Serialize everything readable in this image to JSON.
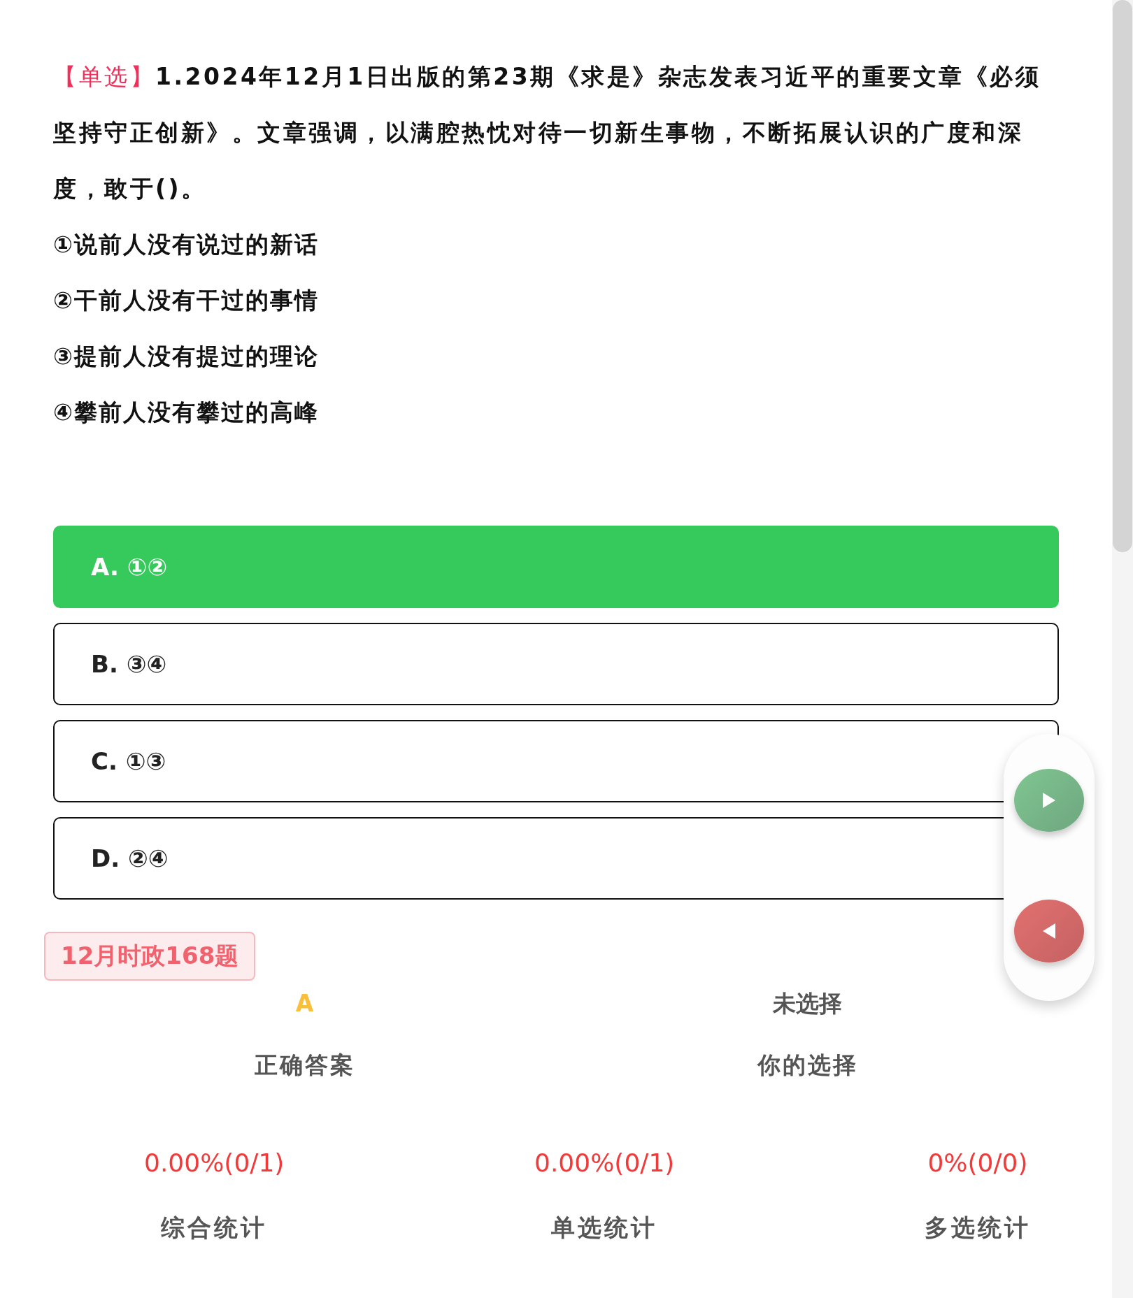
{
  "question": {
    "type_tag": "【单选】",
    "text": "1.2024年12月1日出版的第23期《求是》杂志发表习近平的重要文章《必须坚持守正创新》。文章强调，以满腔热忱对待一切新生事物，不断拓展认识的广度和深度，敢于()。",
    "statements": [
      "①说前人没有说过的新话",
      "②干前人没有干过的事情",
      "③提前人没有提过的理论",
      "④攀前人没有攀过的高峰"
    ]
  },
  "options": [
    {
      "label": "A. ①②",
      "correct": true
    },
    {
      "label": "B. ③④",
      "correct": false
    },
    {
      "label": "C. ①③",
      "correct": false
    },
    {
      "label": "D. ②④",
      "correct": false
    }
  ],
  "tag": "12月时政168题",
  "answer": [
    {
      "value": "A",
      "label": "正确答案",
      "kind": "answer"
    },
    {
      "value": "未选择",
      "label": "你的选择",
      "kind": "choice"
    }
  ],
  "stats": [
    {
      "value": "0.00%(0/1)",
      "label": "综合统计"
    },
    {
      "value": "0.00%(0/1)",
      "label": "单选统计"
    },
    {
      "value": "0%(0/0)",
      "label": "多选统计"
    }
  ]
}
